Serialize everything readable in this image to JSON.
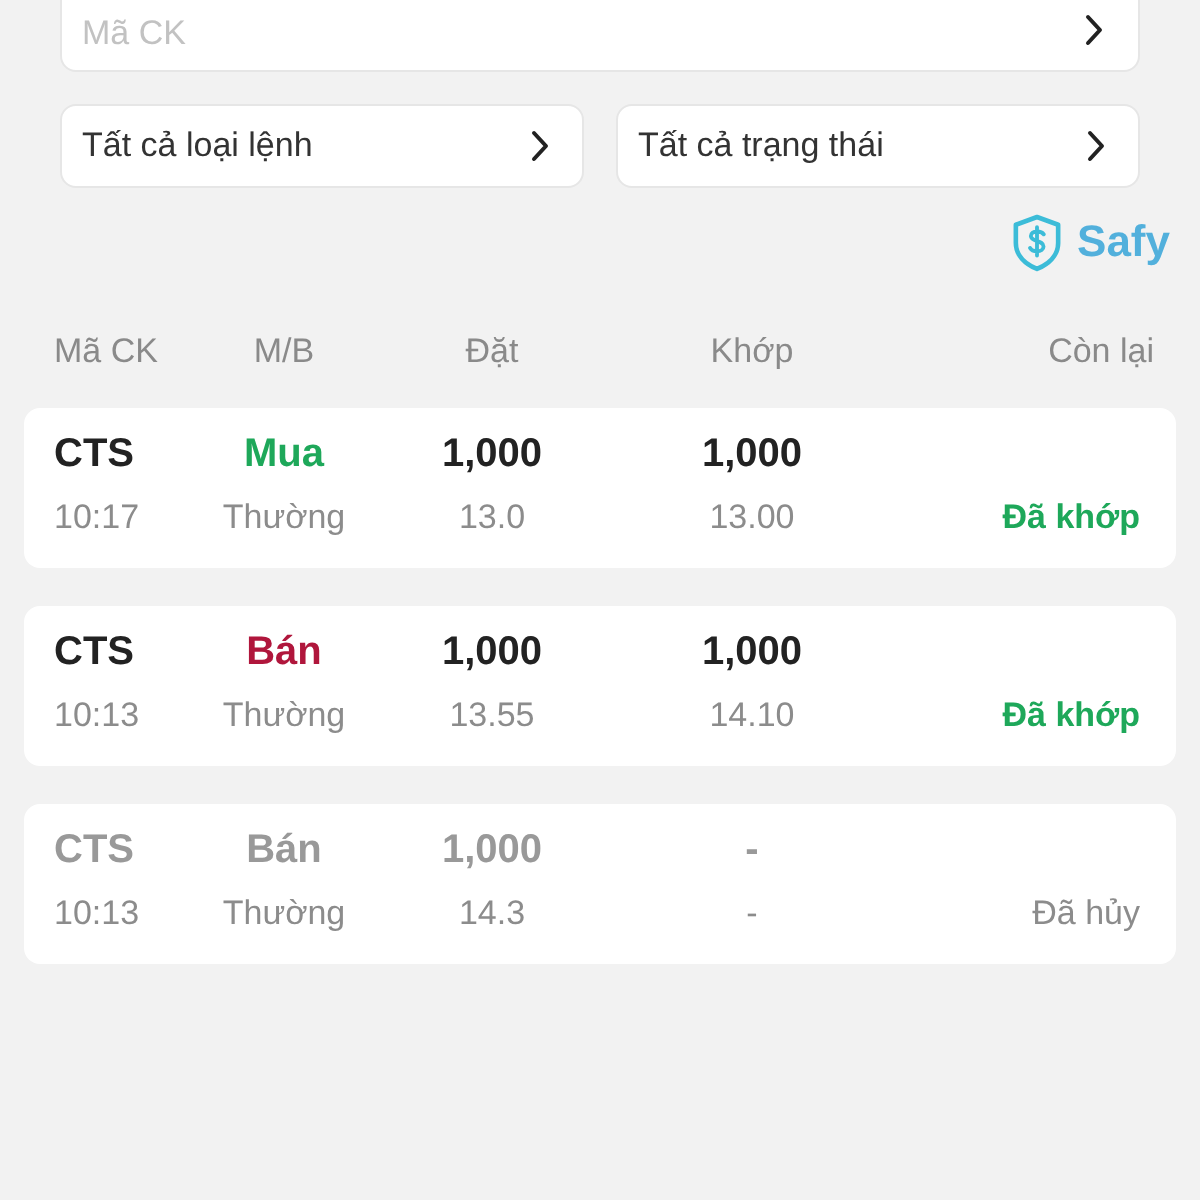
{
  "stock_field": {
    "placeholder": "Mã CK"
  },
  "filters": [
    {
      "label": "Tất cả loại lệnh"
    },
    {
      "label": "Tất cả trạng thái"
    }
  ],
  "brand": {
    "name": "Safy"
  },
  "table": {
    "columns": [
      "Mã CK",
      "M/B",
      "Đặt",
      "Khớp",
      "Còn lại"
    ],
    "rows": [
      {
        "symbol": "CTS",
        "time": "10:17",
        "side": {
          "label": "Mua",
          "kind": "buy"
        },
        "order_type": "Thường",
        "order_qty": "1,000",
        "order_price": "13.0",
        "match_qty": "1,000",
        "match_price": "13.00",
        "status": {
          "label": "Đã khớp",
          "kind": "matched"
        }
      },
      {
        "symbol": "CTS",
        "time": "10:13",
        "side": {
          "label": "Bán",
          "kind": "sell"
        },
        "order_type": "Thường",
        "order_qty": "1,000",
        "order_price": "13.55",
        "match_qty": "1,000",
        "match_price": "14.10",
        "status": {
          "label": "Đã khớp",
          "kind": "matched"
        }
      },
      {
        "symbol": "CTS",
        "time": "10:13",
        "side": {
          "label": "Bán",
          "kind": "sell"
        },
        "order_type": "Thường",
        "order_qty": "1,000",
        "order_price": "14.3",
        "match_qty": "-",
        "match_price": "-",
        "status": {
          "label": "Đã hủy",
          "kind": "cancelled"
        }
      }
    ]
  }
}
